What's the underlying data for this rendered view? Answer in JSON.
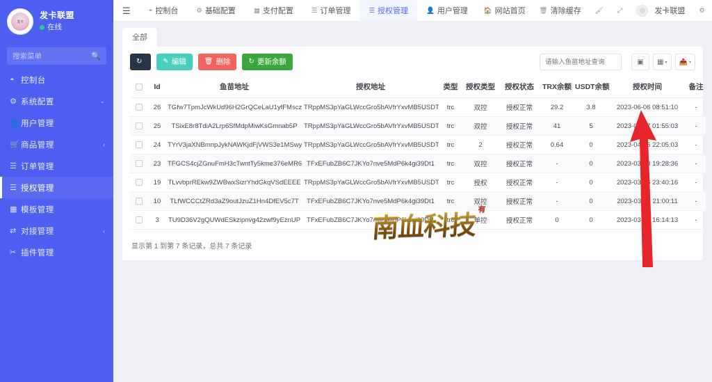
{
  "sidebar": {
    "profile": {
      "name": "发卡联盟",
      "status": "在线",
      "avatar_text": "发卡"
    },
    "search": {
      "placeholder": "搜索菜单",
      "icon": "search-icon"
    },
    "items": [
      {
        "label": "控制台",
        "icon": "dashboard-icon",
        "caret": "",
        "active": false
      },
      {
        "label": "系统配置",
        "icon": "gear-icon",
        "caret": "⌄",
        "active": false
      },
      {
        "label": "用户管理",
        "icon": "user-icon",
        "caret": "",
        "active": false
      },
      {
        "label": "商品管理",
        "icon": "cart-icon",
        "caret": "‹",
        "active": false
      },
      {
        "label": "订单管理",
        "icon": "list-icon",
        "caret": "",
        "active": false
      },
      {
        "label": "授权管理",
        "icon": "list-icon",
        "caret": "",
        "active": true
      },
      {
        "label": "模板管理",
        "icon": "window-icon",
        "caret": "",
        "active": false
      },
      {
        "label": "对接管理",
        "icon": "exchange-icon",
        "caret": "‹",
        "active": false
      },
      {
        "label": "插件管理",
        "icon": "plug-icon",
        "caret": "",
        "active": false
      }
    ]
  },
  "topbar": {
    "menu_toggle_icon": "hamburger-icon",
    "nav": [
      {
        "label": "控制台",
        "icon": "dashboard-icon",
        "active": false
      },
      {
        "label": "基础配置",
        "icon": "gear-icon",
        "active": false
      },
      {
        "label": "支付配置",
        "icon": "card-icon",
        "active": false
      },
      {
        "label": "订单管理",
        "icon": "list-icon",
        "active": false
      },
      {
        "label": "授权管理",
        "icon": "list-icon",
        "active": true
      },
      {
        "label": "用户管理",
        "icon": "user-icon",
        "active": false
      }
    ],
    "right": [
      {
        "label": "网站首页",
        "icon": "home-icon"
      },
      {
        "label": "清除缓存",
        "icon": "trash-icon"
      }
    ],
    "theme_icon": "brush-icon",
    "fullscreen_icon": "expand-icon",
    "account_name": "发卡联盟",
    "account_icon": "avatar-icon",
    "settings_icon": "sliders-icon"
  },
  "tabs": [
    {
      "label": "全部",
      "active": true
    }
  ],
  "toolbar": {
    "refresh_icon": "refresh-icon",
    "refresh_label": "",
    "edit_label": "编辑",
    "edit_icon": "pencil-icon",
    "delete_label": "删除",
    "delete_icon": "trash-icon",
    "update_balance_label": "更新余额",
    "update_balance_icon": "refresh-icon",
    "search_placeholder": "请输入鱼苗地址查询",
    "icon_buttons": [
      {
        "icon": "fullscreen-table-icon",
        "caret": ""
      },
      {
        "icon": "columns-icon",
        "caret": "▾"
      },
      {
        "icon": "export-icon",
        "caret": "▾"
      }
    ]
  },
  "table": {
    "headers": {
      "checkbox": "",
      "id": "Id",
      "fish_address": "鱼苗地址",
      "auth_address": "授权地址",
      "type": "类型",
      "auth_type": "授权类型",
      "auth_state": "授权状态",
      "trx_balance": "TRX余额",
      "usdt_balance": "USDT余额",
      "auth_time": "授权时间",
      "note": "备注"
    },
    "rows": [
      {
        "id": "26",
        "fish_address": "TGfw7TpmJcWkUd96H2GrQCeLaU1yfFMscz",
        "auth_address": "TRppMS3pYaGLWccGro5bAVfrYxvMB5USDT",
        "type": "trc",
        "auth_type": "双控",
        "auth_state": "授权正常",
        "trx_balance": "29.2",
        "usdt_balance": "3.8",
        "auth_time": "2023-06-06 08:51:10",
        "note": "-"
      },
      {
        "id": "25",
        "fish_address": "TSixE8r8TdiA2Lrp6SfMdpMiwKsGmnab5P",
        "auth_address": "TRppMS3pYaGLWccGro5bAVfrYxvMB5USDT",
        "type": "trc",
        "auth_type": "双控",
        "auth_state": "授权正常",
        "trx_balance": "41",
        "usdt_balance": "5",
        "auth_time": "2023-05-07 01:55:03",
        "note": "-"
      },
      {
        "id": "24",
        "fish_address": "TYrV3jaXNBmnpJykNAWKjdFjVWS3e1MSwy",
        "auth_address": "TRppMS3pYaGLWccGro5bAVfrYxvMB5USDT",
        "type": "trc",
        "auth_type": "2",
        "auth_state": "授权正常",
        "trx_balance": "0.64",
        "usdt_balance": "0",
        "auth_time": "2023-04-06 22:05:03",
        "note": "-"
      },
      {
        "id": "23",
        "fish_address": "TFGCS4cjZGnuFmH3cTwntTy5kme376eMR6",
        "auth_address": "TFxEFubZB6C7JKYo7nve5MdP6k4gi39Dt1",
        "type": "trc",
        "auth_type": "双控",
        "auth_state": "授权正常",
        "trx_balance": "-",
        "usdt_balance": "0",
        "auth_time": "2023-03-23 19:28:36",
        "note": "-"
      },
      {
        "id": "19",
        "fish_address": "TLvvbprREkw9ZWBwxSizrYhdGkqVSdEEEE",
        "auth_address": "TRppMS3pYaGLWccGro5bAVfrYxvMB5USDT",
        "type": "trc",
        "auth_type": "授权",
        "auth_state": "授权正常",
        "trx_balance": "-",
        "usdt_balance": "0",
        "auth_time": "2023-03-16 23:40:16",
        "note": "-"
      },
      {
        "id": "10",
        "fish_address": "TLfWCCCtZRd3aZ9outJzuZ1Hn4DfEV5c7T",
        "auth_address": "TFxEFubZB6C7JKYo7nve5MdP6k4gi39Dt1",
        "type": "trc",
        "auth_type": "双控",
        "auth_state": "授权正常",
        "trx_balance": "-",
        "usdt_balance": "0",
        "auth_time": "2023-03-17 21:00:11",
        "note": "-"
      },
      {
        "id": "3",
        "fish_address": "TU9D36V2gQUWdESkzipnvg42zwf9yEznUP",
        "auth_address": "TFxEFubZB6C7JKYo7nve5MdP6k4gi39Dt1",
        "type": "trc",
        "auth_type": "单控",
        "auth_state": "授权正常",
        "trx_balance": "0",
        "usdt_balance": "0",
        "auth_time": "2023-03-03 16:14:13",
        "note": "-"
      }
    ],
    "footer": "显示第 1 到第 7 条记录，总共 7 条记录"
  },
  "watermark": {
    "text": "南血科技",
    "mark": "有"
  },
  "annotation": {
    "arrow_color": "#e8252a",
    "shape": "up-arrow"
  },
  "colors": {
    "sidebar_bg": "#4d5ff0",
    "accent": "#4d6af0",
    "page_bg": "#eef0f5",
    "btn_dark": "#283446",
    "btn_teal": "#49cfbe",
    "btn_red": "#f1635c",
    "btn_green": "#3aa63d",
    "online_dot": "#1fd18a"
  }
}
